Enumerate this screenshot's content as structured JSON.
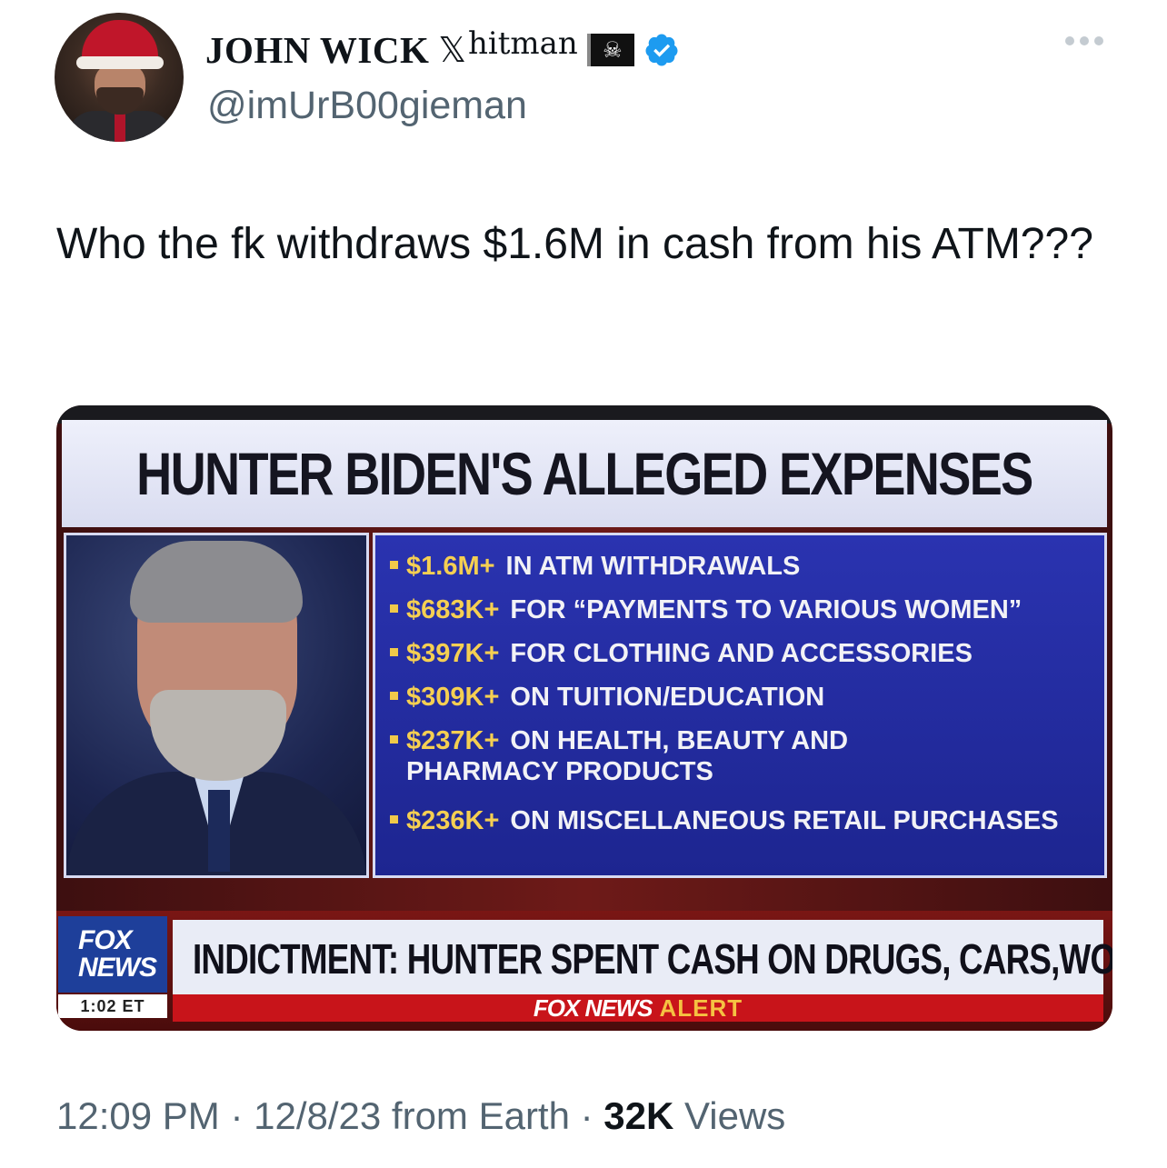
{
  "author": {
    "display_name": "JOHN WICK",
    "x_symbol": "𝕏",
    "suffix": "hitman",
    "flag_icon": "☠",
    "handle": "@imUrB00gieman",
    "verified_color": "#1d9bf0"
  },
  "tweet": {
    "text": "Who the fk withdraws $1.6M in cash from his ATM???"
  },
  "media": {
    "headline": "HUNTER BIDEN'S ALLEGED EXPENSES",
    "items": [
      {
        "amount": "$1.6M+",
        "desc": "IN ATM WITHDRAWALS"
      },
      {
        "amount": "$683K+",
        "desc": "FOR “PAYMENTS TO VARIOUS WOMEN”"
      },
      {
        "amount": "$397K+",
        "desc": "FOR CLOTHING AND ACCESSORIES"
      },
      {
        "amount": "$309K+",
        "desc": "ON TUITION/EDUCATION"
      },
      {
        "amount": "$237K+",
        "desc": "ON HEALTH, BEAUTY AND",
        "cont": "PHARMACY PRODUCTS"
      },
      {
        "amount": "$236K+",
        "desc": "ON MISCELLANEOUS RETAIL PURCHASES"
      }
    ],
    "logo_line1": "FOX",
    "logo_line2": "NEWS",
    "time": "1:02 ET",
    "ticker": "INDICTMENT: HUNTER SPENT CASH ON DRUGS, CARS,WOMEN",
    "alert_brand": "FOX NEWS",
    "alert_word": "ALERT"
  },
  "meta": {
    "time": "12:09 PM",
    "sep1": " · ",
    "date_source": "12/8/23 from Earth",
    "sep2": " · ",
    "views_count": "32K",
    "views_label": " Views"
  }
}
